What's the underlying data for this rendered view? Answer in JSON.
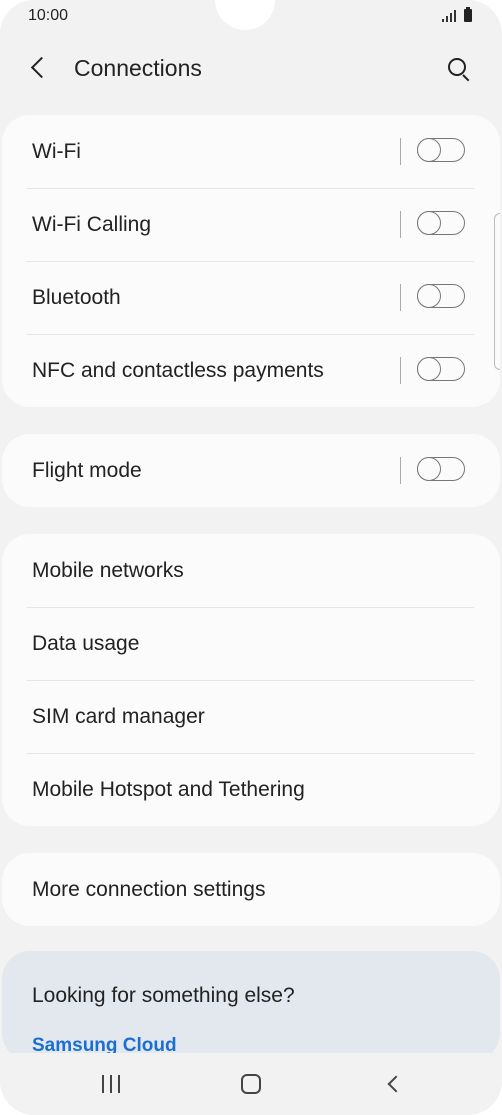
{
  "status_bar": {
    "time": "10:00"
  },
  "header": {
    "title": "Connections"
  },
  "groups": [
    {
      "items": [
        {
          "label": "Wi-Fi",
          "toggle": "off"
        },
        {
          "label": "Wi-Fi Calling",
          "toggle": "off"
        },
        {
          "label": "Bluetooth",
          "toggle": "off"
        },
        {
          "label": "NFC and contactless payments",
          "toggle": "off"
        }
      ]
    },
    {
      "items": [
        {
          "label": "Flight mode",
          "toggle": "off"
        }
      ]
    },
    {
      "items": [
        {
          "label": "Mobile networks"
        },
        {
          "label": "Data usage"
        },
        {
          "label": "SIM card manager"
        },
        {
          "label": "Mobile Hotspot and Tethering"
        }
      ]
    },
    {
      "items": [
        {
          "label": "More connection settings"
        }
      ]
    }
  ],
  "suggestions": {
    "title": "Looking for something else?",
    "link": "Samsung Cloud"
  },
  "colors": {
    "background": "#f2f2f2",
    "card": "#fbfbfb",
    "suggest_card": "#e3e8ef",
    "link": "#1a6fd1"
  },
  "icons": [
    "back-icon",
    "search-icon",
    "signal-icon",
    "battery-icon",
    "recents-icon",
    "home-icon",
    "nav-back-icon"
  ]
}
